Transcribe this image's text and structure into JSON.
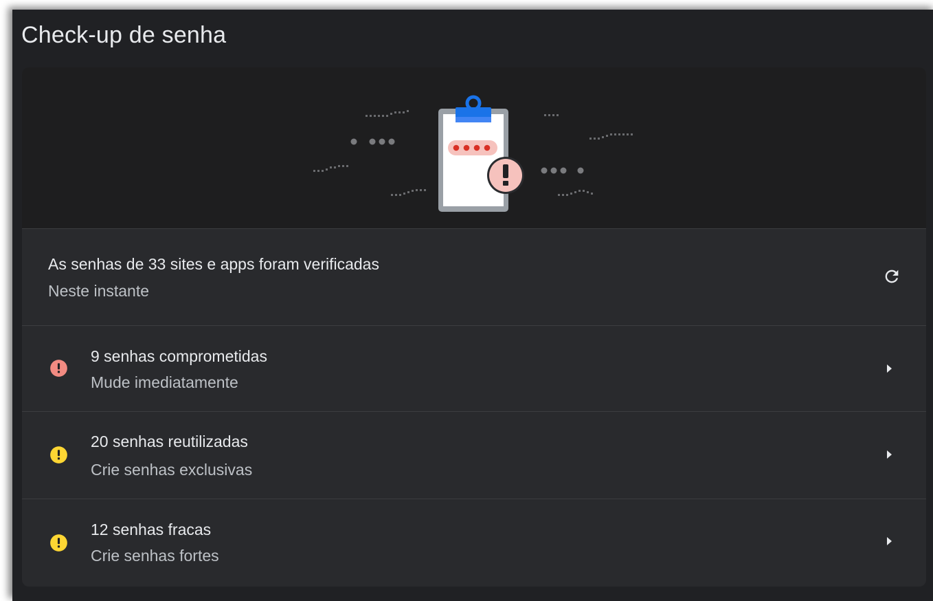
{
  "header": {
    "title": "Check-up de senha"
  },
  "banner": {
    "illustration": "clipboard-password-alert"
  },
  "status": {
    "title": "As senhas de 33 sites e apps foram verificadas",
    "subtitle": "Neste instante",
    "action_icon": "refresh-icon"
  },
  "issues": [
    {
      "title": "9 senhas comprometidas",
      "subtitle": "Mude imediatamente",
      "icon": "error-icon",
      "color": "#f28b82"
    },
    {
      "title": "20 senhas reutilizadas",
      "subtitle": "Crie senhas exclusivas",
      "icon": "warning-icon",
      "color": "#fdd633"
    },
    {
      "title": "12 senhas fracas",
      "subtitle": "Crie senhas fortes",
      "icon": "warning-icon",
      "color": "#fdd633"
    }
  ],
  "colors": {
    "background": "#202124",
    "card": "#292a2d",
    "banner": "#1e1e1f",
    "text_primary": "#e8eaed",
    "text_secondary": "#bdc1c6",
    "accent_blue": "#1a73e8"
  }
}
